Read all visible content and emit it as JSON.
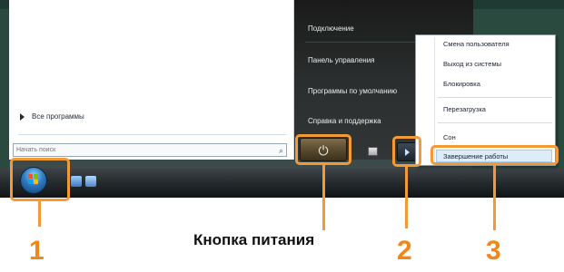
{
  "start_menu": {
    "all_programs": "Все программы",
    "search_placeholder": "Начать поиск",
    "right_items": [
      "Подключение",
      "Панель управления",
      "Программы по умолчанию",
      "Справка и поддержка"
    ]
  },
  "power_menu": {
    "items": [
      "Смена пользователя",
      "Выход из системы",
      "Блокировка",
      "Перезагрузка",
      "Сон",
      "Завершение работы"
    ],
    "selected": "Завершение работы"
  },
  "icons": {
    "search": "search-icon",
    "power": "power-icon",
    "lock": "lock-icon",
    "arrow": "arrow-right-icon",
    "start": "windows-start-orb-icon"
  },
  "annotations": {
    "label_1": "1",
    "label_2": "2",
    "label_3": "3",
    "caption": "Кнопка питания",
    "highlight_color": "#f39a35"
  }
}
